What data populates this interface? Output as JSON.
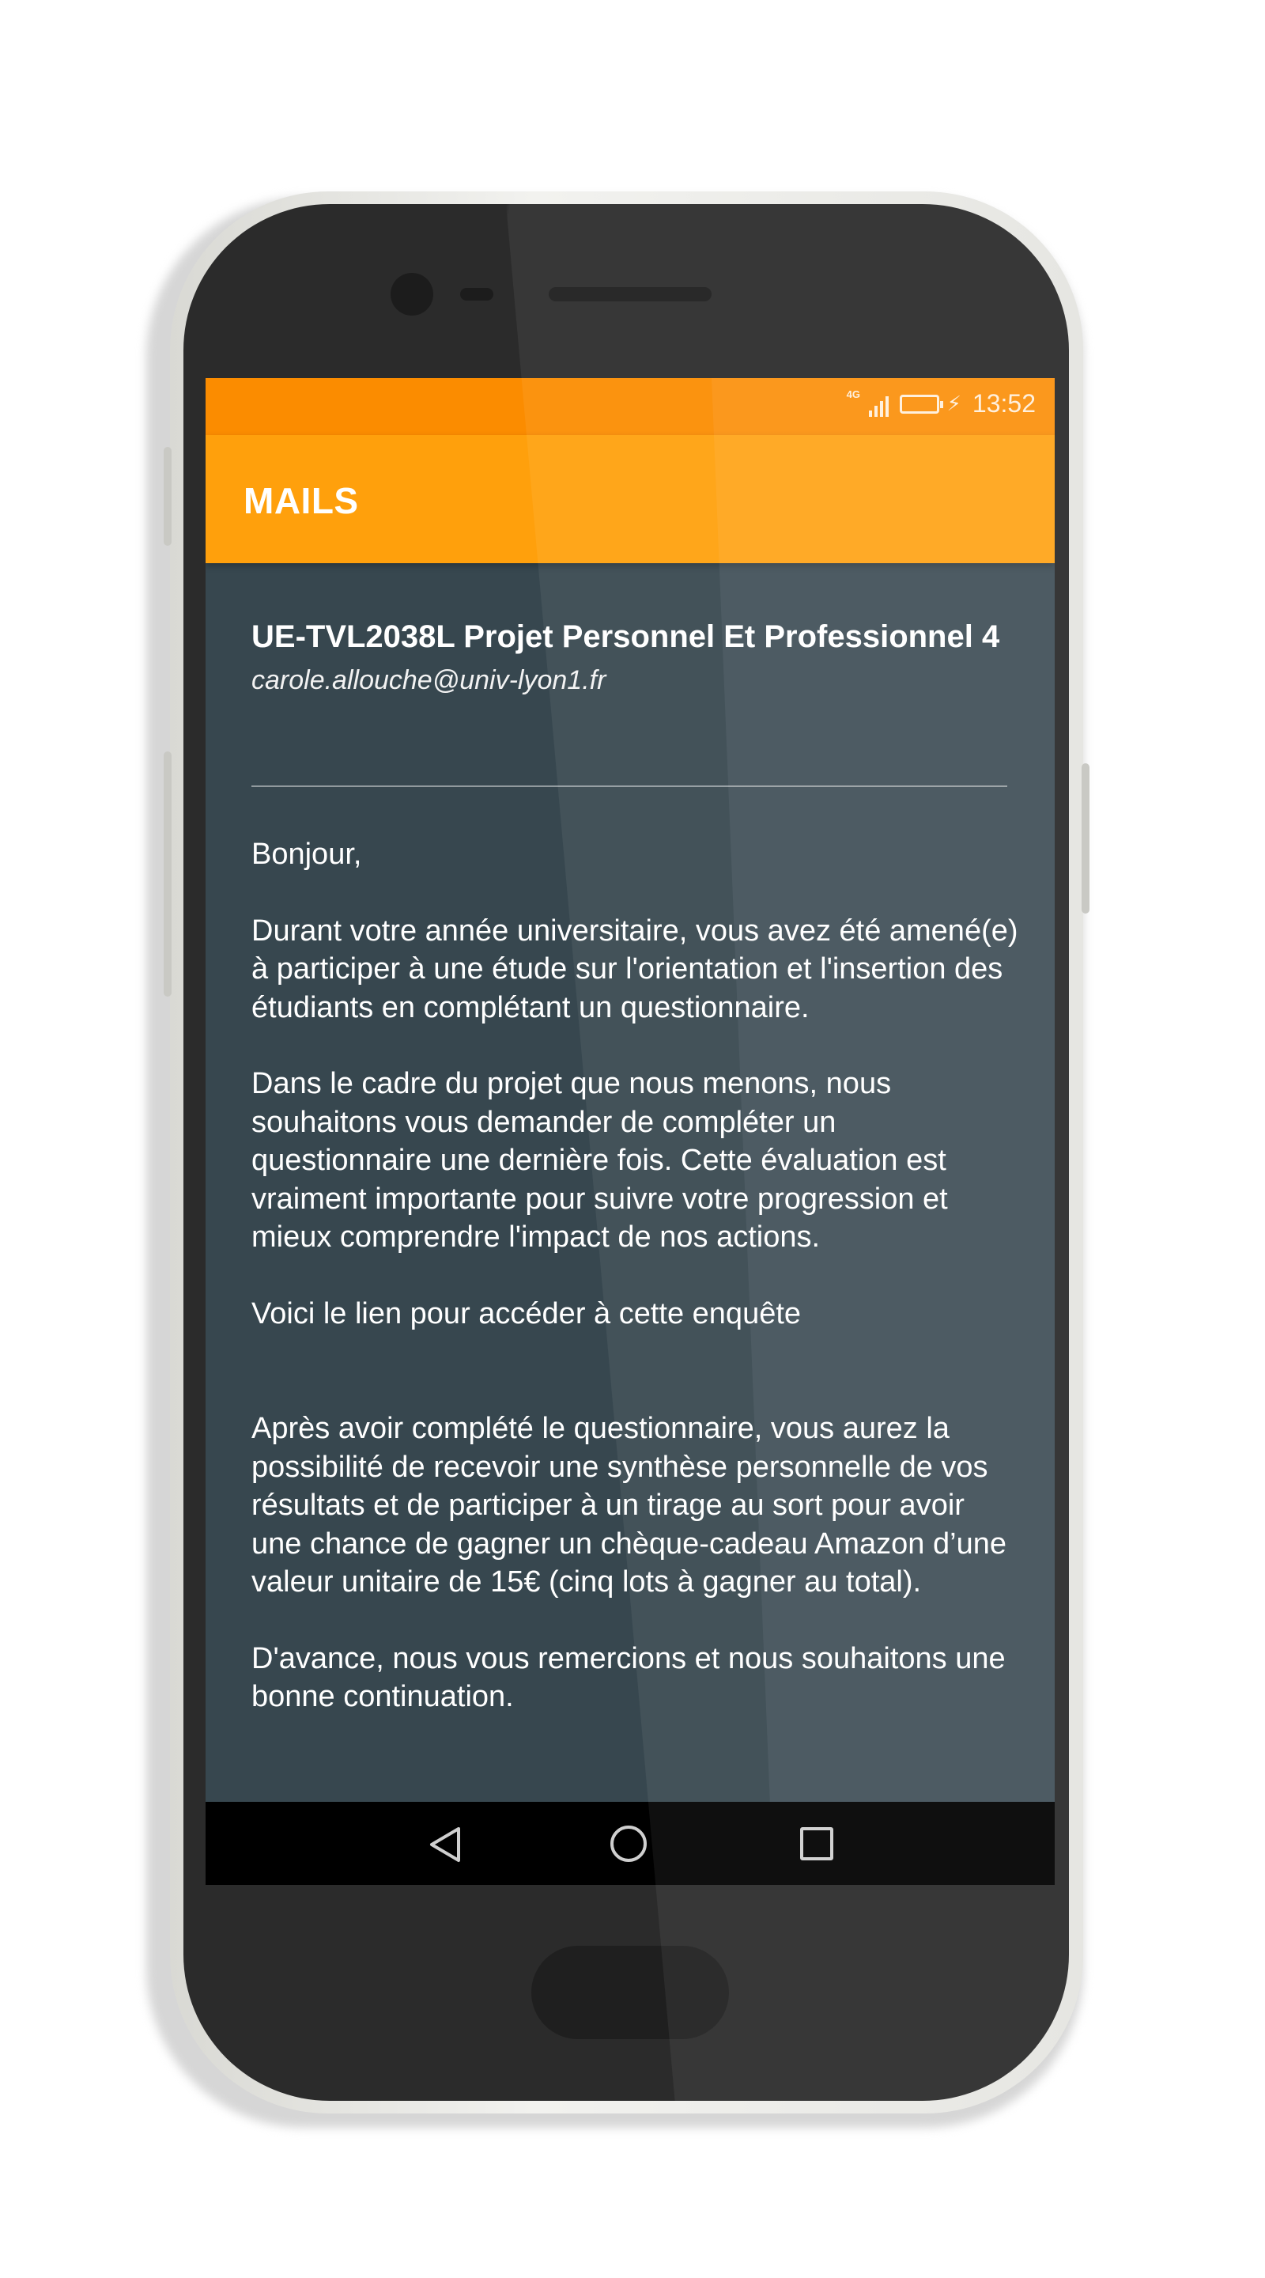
{
  "status_bar": {
    "time": "13:52",
    "network": "4G",
    "icons": [
      "signal-icon",
      "battery-icon",
      "charging-icon"
    ]
  },
  "app_bar": {
    "title": "MAILS"
  },
  "mail": {
    "subject": "UE-TVL2038L Projet Personnel Et Professionnel 4",
    "sender": "carole.allouche@univ-lyon1.fr",
    "paragraphs": [
      "Bonjour,",
      "Durant votre année universitaire, vous avez été amené(e) à participer à une étude sur l'orientation et l'insertion des étudiants en complétant un questionnaire.",
      "Dans le cadre du projet que nous menons, nous souhaitons vous demander de compléter un questionnaire une dernière fois. Cette évaluation est vraiment importante pour suivre votre progression et mieux comprendre l'impact de nos actions.",
      "Voici le lien pour accéder à cette enquête",
      "Après avoir complété le questionnaire, vous aurez la possibilité de recevoir une synthèse personnelle de vos résultats et de participer à un tirage au sort pour avoir une chance de gagner un chèque-cadeau Amazon d’une valeur unitaire de 15€ (cinq lots à gagner au total).",
      "D'avance, nous vous remercions et nous souhaitons une bonne continuation."
    ]
  },
  "nav_bar": {
    "icons": [
      "back-icon",
      "home-icon",
      "recent-apps-icon"
    ]
  },
  "colors": {
    "status_bar": "#fb8c00",
    "app_bar": "#ffa00c",
    "background": "#37474f",
    "nav_bar": "#000000"
  }
}
